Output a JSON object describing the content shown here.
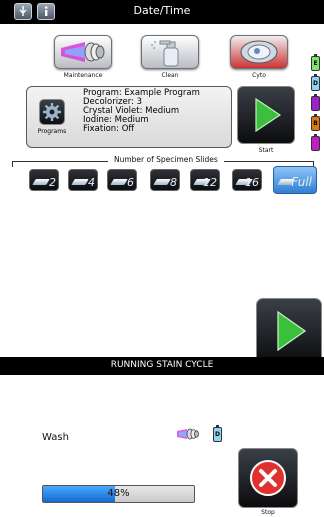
{
  "header": {
    "title": "Date/Time",
    "icons": [
      "usb-icon",
      "info-icon"
    ]
  },
  "actions": {
    "maintenance_label": "Maintenance",
    "clean_label": "Clean",
    "cyto_label": "Cyto",
    "programs_label": "Programs",
    "start_label": "Start"
  },
  "program": {
    "line1": "Program: Example Program",
    "line2": "Decolorizer: 3",
    "line3": "Crystal Violet: Medium",
    "line4": "Iodine: Medium",
    "line5": "Fixation: Off"
  },
  "reagents": [
    {
      "letter": "E",
      "color": "#7ee86e"
    },
    {
      "letter": "D",
      "color": "#8fd4f4"
    },
    {
      "letter": "",
      "color": "#a020d0"
    },
    {
      "letter": "B",
      "color": "#e07a10"
    },
    {
      "letter": "",
      "color": "#c020c0"
    }
  ],
  "slides": {
    "title": "Number of Specimen Slides",
    "options": [
      "2",
      "4",
      "6",
      "8",
      "12",
      "16",
      "Full"
    ]
  },
  "run": {
    "title": "RUNNING STAIN CYCLE",
    "step": "Wash",
    "reagent_letter": "D",
    "progress_text": "48%",
    "progress": 0.48,
    "stop_label": "Stop"
  },
  "colors": {
    "bar_black": "#000000",
    "start_green": "#3cbf3c",
    "stop_red": "#e03030",
    "progress_blue": "#1e90ff",
    "full_blue": "#2f7fd6"
  }
}
